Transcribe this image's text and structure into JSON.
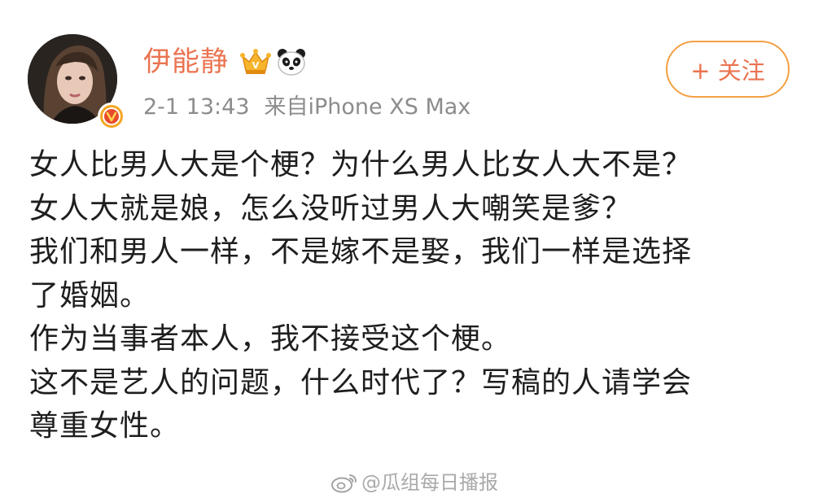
{
  "post": {
    "author": {
      "name": "伊能静",
      "avatar_icon": "profile-photo",
      "verified_icon": "verified-v-icon",
      "badges": [
        "crown-icon",
        "panda-icon"
      ]
    },
    "time": "2-1 13:43",
    "source": "来自iPhone XS Max",
    "follow_label": "+ 关注",
    "lines": [
      "女人比男人大是个梗？为什么男人比女人大不是？",
      "女人大就是娘，怎么没听过男人大嘲笑是爹？",
      "我们和男人一样，不是嫁不是娶，我们一样是选择",
      "了婚姻。",
      "作为当事者本人，我不接受这个梗。",
      "这不是艺人的问题，什么时代了？写稿的人请学会",
      "尊重女性。"
    ]
  },
  "watermark": {
    "text": "@瓜组每日播报",
    "icon": "weibo-logo-icon"
  },
  "colors": {
    "username": "#eb7350",
    "follow_border": "#f5a043",
    "meta": "#8c8c8c",
    "body_text": "#1e1e1e",
    "verified": "#f5a623"
  }
}
